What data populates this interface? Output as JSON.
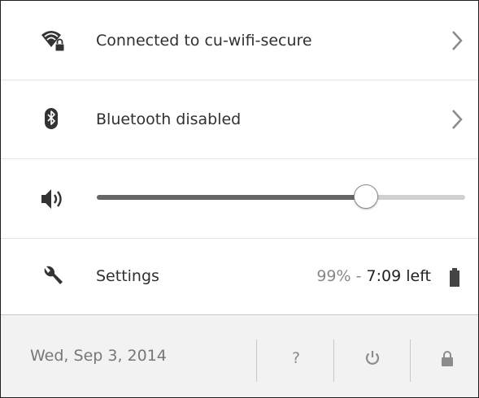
{
  "network": {
    "label": "Connected to cu-wifi-secure",
    "icon": "wifi-lock-icon"
  },
  "bluetooth": {
    "label": "Bluetooth disabled",
    "icon": "bluetooth-icon"
  },
  "volume": {
    "icon": "speaker-icon",
    "level_percent": 73
  },
  "settings": {
    "label": "Settings",
    "icon": "wrench-icon"
  },
  "battery": {
    "percent_text": "99%",
    "separator": " - ",
    "time_left": "7:09 left",
    "icon": "battery-icon"
  },
  "footer": {
    "date": "Wed, Sep 3, 2014",
    "help_label": "?",
    "power_icon": "power-icon",
    "lock_icon": "lock-icon"
  },
  "colors": {
    "text": "#303030",
    "muted": "#888888",
    "slider_fill": "#666666",
    "slider_track": "#d0d0d0",
    "footer_bg": "#f2f2f2"
  }
}
